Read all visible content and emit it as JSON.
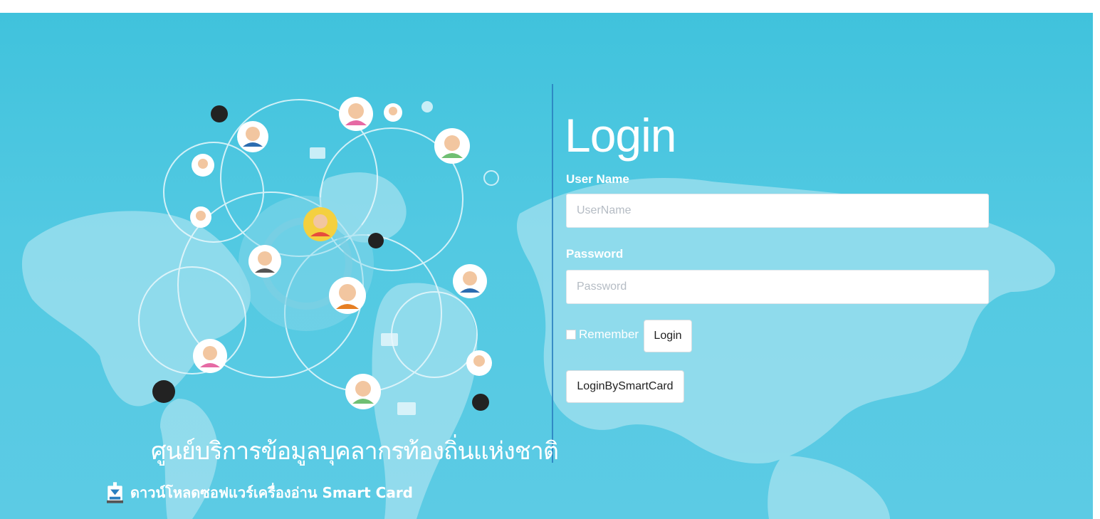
{
  "branding": {
    "site_title": "ศูนย์บริการข้อมูลบุคลากรท้องถิ่นแห่งชาติ",
    "download_link": "ดาวน์โหลดซอฟแวร์เครื่องอ่าน Smart Card"
  },
  "login": {
    "heading": "Login",
    "username_label": "User Name",
    "username_placeholder": "UserName",
    "password_label": "Password",
    "password_placeholder": "Password",
    "remember_label": "Remember",
    "remember_checked": false,
    "login_button": "Login",
    "smartcard_button": "LoginBySmartCard"
  },
  "colors": {
    "background": "#4cc6e0",
    "divider": "#2a7fc0",
    "text_light": "#ffffff"
  },
  "icons": [
    "download-icon",
    "people-network-illustration",
    "world-map-background"
  ]
}
